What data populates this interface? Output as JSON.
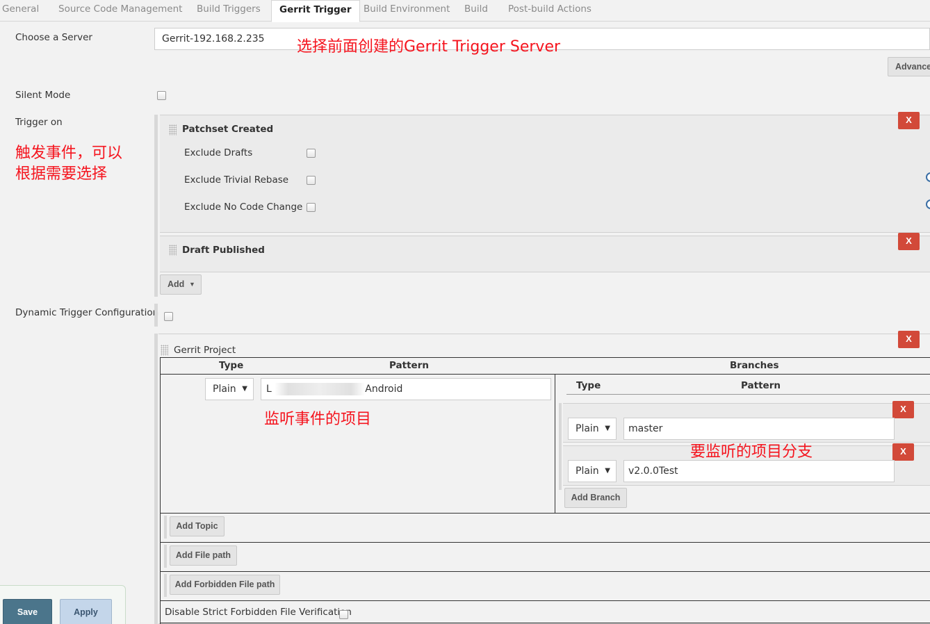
{
  "tabs": [
    "General",
    "Source Code Management",
    "Build Triggers",
    "Gerrit Trigger",
    "Build Environment",
    "Build",
    "Post-build Actions"
  ],
  "server": {
    "label": "Choose a Server",
    "value": "Gerrit-192.168.2.235",
    "annotation": "选择前面创建的Gerrit Trigger Server",
    "advanced_button": "Advance"
  },
  "silent_mode": {
    "label": "Silent Mode",
    "checked": false
  },
  "trigger_on": {
    "label": "Trigger on",
    "annotation_line1": "触发事件，可以",
    "annotation_line2": "根据需要选择",
    "events": [
      {
        "title": "Patchset Created",
        "options": [
          {
            "label": "Exclude Drafts",
            "checked": false
          },
          {
            "label": "Exclude Trivial Rebase",
            "checked": false
          },
          {
            "label": "Exclude No Code Change",
            "checked": false
          }
        ]
      },
      {
        "title": "Draft Published",
        "options": []
      }
    ],
    "add_button": "Add",
    "delete_label": "X"
  },
  "dynamic": {
    "label": "Dynamic Trigger Configuration",
    "checked": false
  },
  "gerrit_project": {
    "title": "Gerrit Project",
    "headers": {
      "type": "Type",
      "pattern": "Pattern",
      "branches": "Branches"
    },
    "project_type": "Plain",
    "project_pattern_start": "L",
    "project_pattern_end": "Android",
    "project_annotation": "监听事件的项目",
    "branch_headers": {
      "type": "Type",
      "pattern": "Pattern"
    },
    "branches": [
      {
        "type": "Plain",
        "pattern": "master"
      },
      {
        "type": "Plain",
        "pattern": "v2.0.0Test"
      }
    ],
    "branch_annotation": "要监听的项目分支",
    "add_branch": "Add Branch",
    "add_topic": "Add Topic",
    "add_file_path": "Add File path",
    "add_forbidden_file_path": "Add Forbidden File path",
    "disable_strict": "Disable Strict Forbidden File Verification"
  },
  "footer": {
    "save": "Save",
    "apply": "Apply"
  },
  "colors": {
    "annotation": "#f5141e",
    "delete": "#d24939",
    "save": "#4b758b",
    "apply": "#c4d6ea"
  }
}
